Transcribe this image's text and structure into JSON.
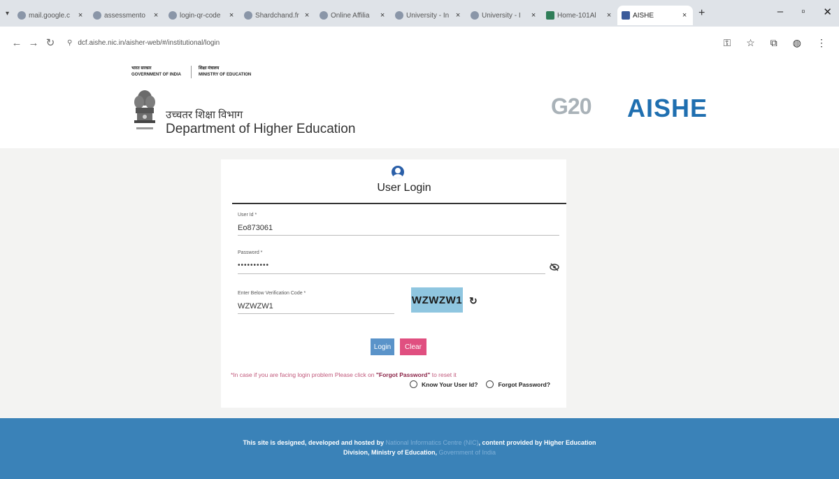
{
  "browser": {
    "tabs": [
      {
        "label": "mail.google.c",
        "icon": "google-icon"
      },
      {
        "label": "assessmento",
        "icon": "site-icon"
      },
      {
        "label": "login-qr-code",
        "icon": "site-icon"
      },
      {
        "label": "Shardchand.fr",
        "icon": "site-icon"
      },
      {
        "label": "Online Affilia",
        "icon": "site-icon"
      },
      {
        "label": "University - In",
        "icon": "globe-icon"
      },
      {
        "label": "University - I",
        "icon": "globe-icon"
      },
      {
        "label": "Home-101Al",
        "icon": "site-icon"
      },
      {
        "label": "AISHE",
        "icon": "aishe-icon",
        "active": true
      }
    ],
    "url": "dcf.aishe.nic.in/aisher-web/#/institutional/login"
  },
  "header": {
    "gov_hindi": "भारत सरकार",
    "gov_english": "GOVERNMENT OF INDIA",
    "ministry_hindi": "शिक्षा मंत्रालय",
    "ministry_english": "MINISTRY OF EDUCATION",
    "dept_hindi": "उच्चतर शिक्षा विभाग",
    "dept_english": "Department of Higher Education",
    "g20_logo": "G20",
    "aishe_logo": "AISHE"
  },
  "login": {
    "title": "User Login",
    "user_id_label": "User Id *",
    "user_id_value": "Eo873061",
    "password_label": "Password *",
    "password_value": "••••••••••",
    "captcha_label": "Enter Below Verification Code *",
    "captcha_value": "WZWZW1",
    "captcha_image_text": "WZWZW1",
    "login_button": "Login",
    "clear_button": "Clear",
    "help_text_prefix": "*In case if you are facing login problem Please click on ",
    "help_text_link": "\"Forgot Password\"",
    "help_text_suffix": " to reset it",
    "know_user_id": "Know Your User Id?",
    "forgot_password": "Forgot Password?"
  },
  "footer": {
    "text_1": "This site is designed, developed and hosted by ",
    "link_1": "National Informatics Centre (NIC)",
    "text_2": ", content provided by Higher Education",
    "text_3": "Division, Ministry of Education, ",
    "link_2": "Government of India"
  },
  "colors": {
    "accent": "#1f6fb0",
    "footer": "#3a82b8",
    "clear_button": "#e04f80",
    "login_button": "#5a93c9",
    "captcha_bg": "#8fc6e0"
  }
}
